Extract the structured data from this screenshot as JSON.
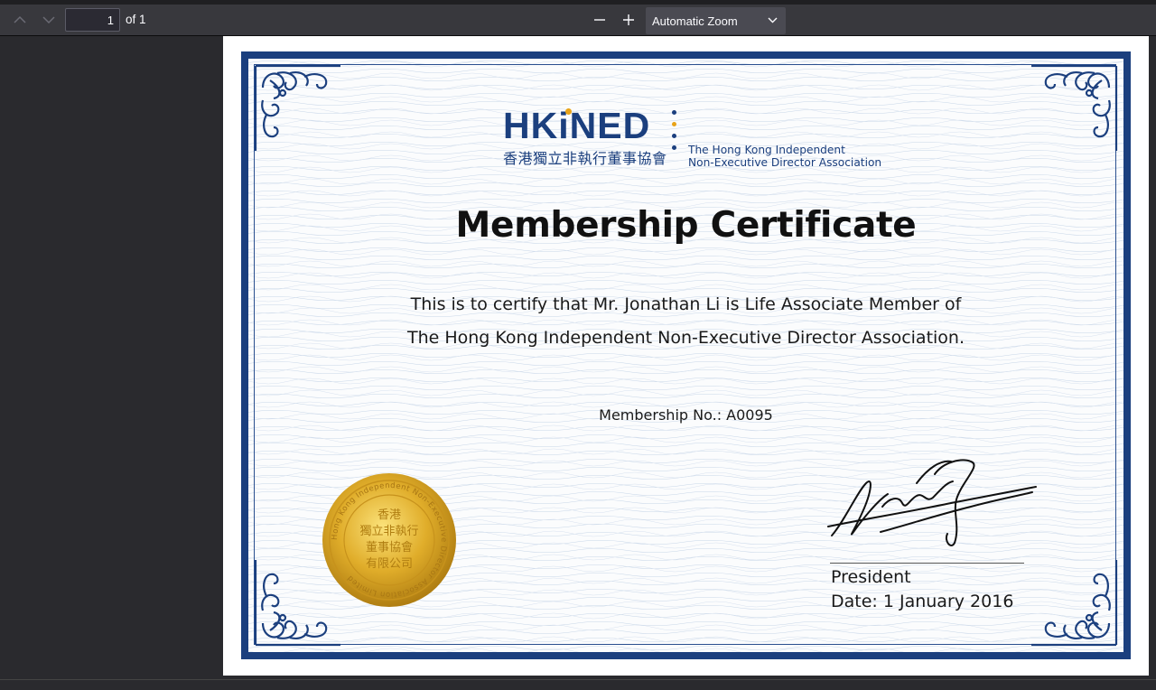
{
  "toolbar": {
    "page_number": "1",
    "page_count": "of 1",
    "zoom_label": "Automatic Zoom"
  },
  "certificate": {
    "logo_main": "HKiNED",
    "logo_cn": "香港獨立非執行董事協會",
    "logo_en_line1": "The Hong Kong Independent",
    "logo_en_line2": "Non-Executive Director Association",
    "title": "Membership Certificate",
    "line1": "This is to certify that Mr. Jonathan Li is Life Associate Member of",
    "line2": "The Hong Kong Independent Non-Executive Director Association.",
    "membership_no": "Membership No.: A0095",
    "seal_cn_line1": "香港",
    "seal_cn_line2": "獨立非執行",
    "seal_cn_line3": "董事協會",
    "seal_cn_line4": "有限公司",
    "seal_ring_text": "Hong Kong Independent Non-Executive Director Association Limited",
    "signatory_title": "President",
    "date": "Date: 1 January 2016"
  },
  "colors": {
    "frame_blue": "#1b3f7e",
    "logo_dot_orange": "#e8a318",
    "seal_gold": "#d9a520",
    "toolbar_bg": "#38383d",
    "viewer_bg": "#2a2a2e"
  },
  "icons": {
    "previous_page": "chevron-up-icon",
    "next_page": "chevron-down-icon",
    "zoom_out": "minus-icon",
    "zoom_in": "plus-icon",
    "zoom_dropdown": "chevron-down-icon"
  }
}
